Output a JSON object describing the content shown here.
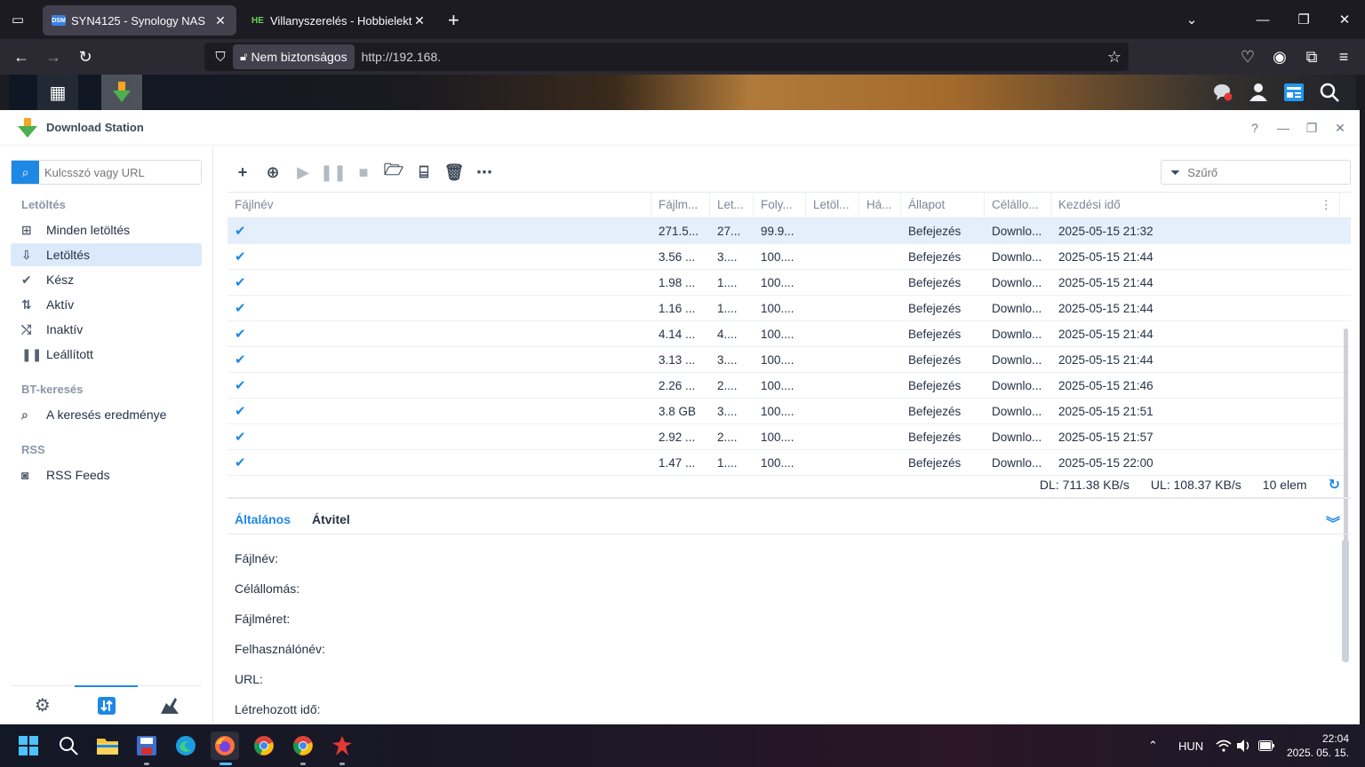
{
  "browser": {
    "tabs": [
      {
        "favicon": "DSM",
        "title": "SYN4125 - Synology NAS",
        "close": "✕"
      },
      {
        "favicon": "HE",
        "title": "Villanyszerelés - Hobbielektronika",
        "close": "✕"
      }
    ],
    "new_tab": "+",
    "security_label": "Nem biztonságos",
    "url": "http://192.168."
  },
  "app": {
    "title": "Download Station",
    "header_buttons": {
      "help": "?",
      "minimize": "—",
      "restore": "❐",
      "close": "✕"
    }
  },
  "sidebar": {
    "search_placeholder": "Kulcsszó vagy URL",
    "sections": [
      {
        "title": "Letöltés",
        "items": [
          {
            "label": "Minden letöltés",
            "icon": "download-box-icon"
          },
          {
            "label": "Letöltés",
            "icon": "download-arrow-icon",
            "selected": true
          },
          {
            "label": "Kész",
            "icon": "check-icon"
          },
          {
            "label": "Aktív",
            "icon": "up-down-arrows-icon"
          },
          {
            "label": "Inaktív",
            "icon": "inactive-icon"
          },
          {
            "label": "Leállított",
            "icon": "pause-icon"
          }
        ]
      },
      {
        "title": "BT-keresés",
        "items": [
          {
            "label": "A keresés eredménye",
            "icon": "search-icon"
          }
        ]
      },
      {
        "title": "RSS",
        "items": [
          {
            "label": "RSS Feeds",
            "icon": "rss-icon"
          }
        ]
      }
    ]
  },
  "toolbar": {
    "filter_placeholder": "Szűrő"
  },
  "grid": {
    "columns": [
      "Fájlnév",
      "Fájlm...",
      "Let...",
      "Foly...",
      "Letöl...",
      "Há...",
      "Állapot",
      "Célállo...",
      "Kezdési idő"
    ],
    "rows": [
      {
        "size": "271.5...",
        "let": "27...",
        "prog": "99.9...",
        "state": "Befejezés",
        "dest": "Downlo...",
        "time": "2025-05-15 21:32",
        "selected": true
      },
      {
        "size": "3.56 ...",
        "let": "3....",
        "prog": "100....",
        "state": "Befejezés",
        "dest": "Downlo...",
        "time": "2025-05-15 21:44"
      },
      {
        "size": "1.98 ...",
        "let": "1....",
        "prog": "100....",
        "state": "Befejezés",
        "dest": "Downlo...",
        "time": "2025-05-15 21:44"
      },
      {
        "size": "1.16 ...",
        "let": "1....",
        "prog": "100....",
        "state": "Befejezés",
        "dest": "Downlo...",
        "time": "2025-05-15 21:44"
      },
      {
        "size": "4.14 ...",
        "let": "4....",
        "prog": "100....",
        "state": "Befejezés",
        "dest": "Downlo...",
        "time": "2025-05-15 21:44"
      },
      {
        "size": "3.13 ...",
        "let": "3....",
        "prog": "100....",
        "state": "Befejezés",
        "dest": "Downlo...",
        "time": "2025-05-15 21:44"
      },
      {
        "size": "2.26 ...",
        "let": "2....",
        "prog": "100....",
        "state": "Befejezés",
        "dest": "Downlo...",
        "time": "2025-05-15 21:46"
      },
      {
        "size": "3.8 GB",
        "let": "3....",
        "prog": "100....",
        "state": "Befejezés",
        "dest": "Downlo...",
        "time": "2025-05-15 21:51"
      },
      {
        "size": "2.92 ...",
        "let": "2....",
        "prog": "100....",
        "state": "Befejezés",
        "dest": "Downlo...",
        "time": "2025-05-15 21:57"
      },
      {
        "size": "1.47 ...",
        "let": "1....",
        "prog": "100....",
        "state": "Befejezés",
        "dest": "Downlo...",
        "time": "2025-05-15 22:00"
      }
    ]
  },
  "status": {
    "dl": "DL: 711.38 KB/s",
    "ul": "UL: 108.37 KB/s",
    "count": "10 elem"
  },
  "details": {
    "tabs": [
      "Általános",
      "Átvitel"
    ],
    "fields": [
      "Fájlnév:",
      "Célállomás:",
      "Fájlméret:",
      "Felhasználónév:",
      "URL:",
      "Létrehozott idő:"
    ]
  },
  "taskbar": {
    "language": "HUN",
    "time": "22:04",
    "date": "2025. 05. 15."
  }
}
